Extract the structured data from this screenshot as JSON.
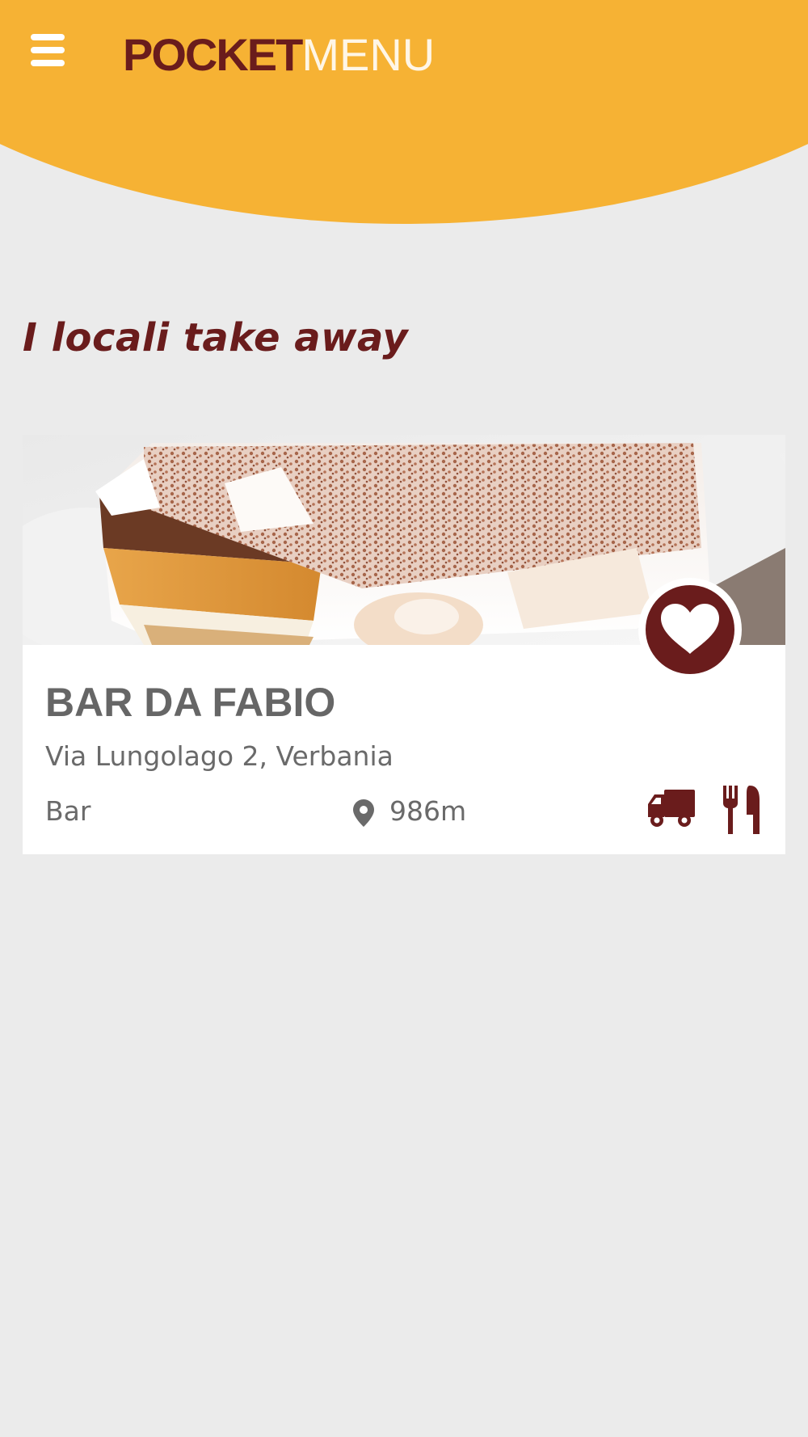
{
  "header": {
    "logo_part1": "POCKET",
    "logo_part2": "MENU",
    "menu_icon": "hamburger-menu-icon"
  },
  "section": {
    "title": "I locali take away"
  },
  "venues": [
    {
      "name": "BAR DA FABIO",
      "address": "Via Lungolago 2, Verbania",
      "category": "Bar",
      "distance": "986m",
      "icons": [
        "heart-icon",
        "location-pin-icon",
        "delivery-truck-icon",
        "fork-knife-icon"
      ]
    }
  ],
  "colors": {
    "header": "#f6b234",
    "brand_dark": "#6a1c1c",
    "background": "#ebebeb",
    "text_gray": "#666666"
  }
}
